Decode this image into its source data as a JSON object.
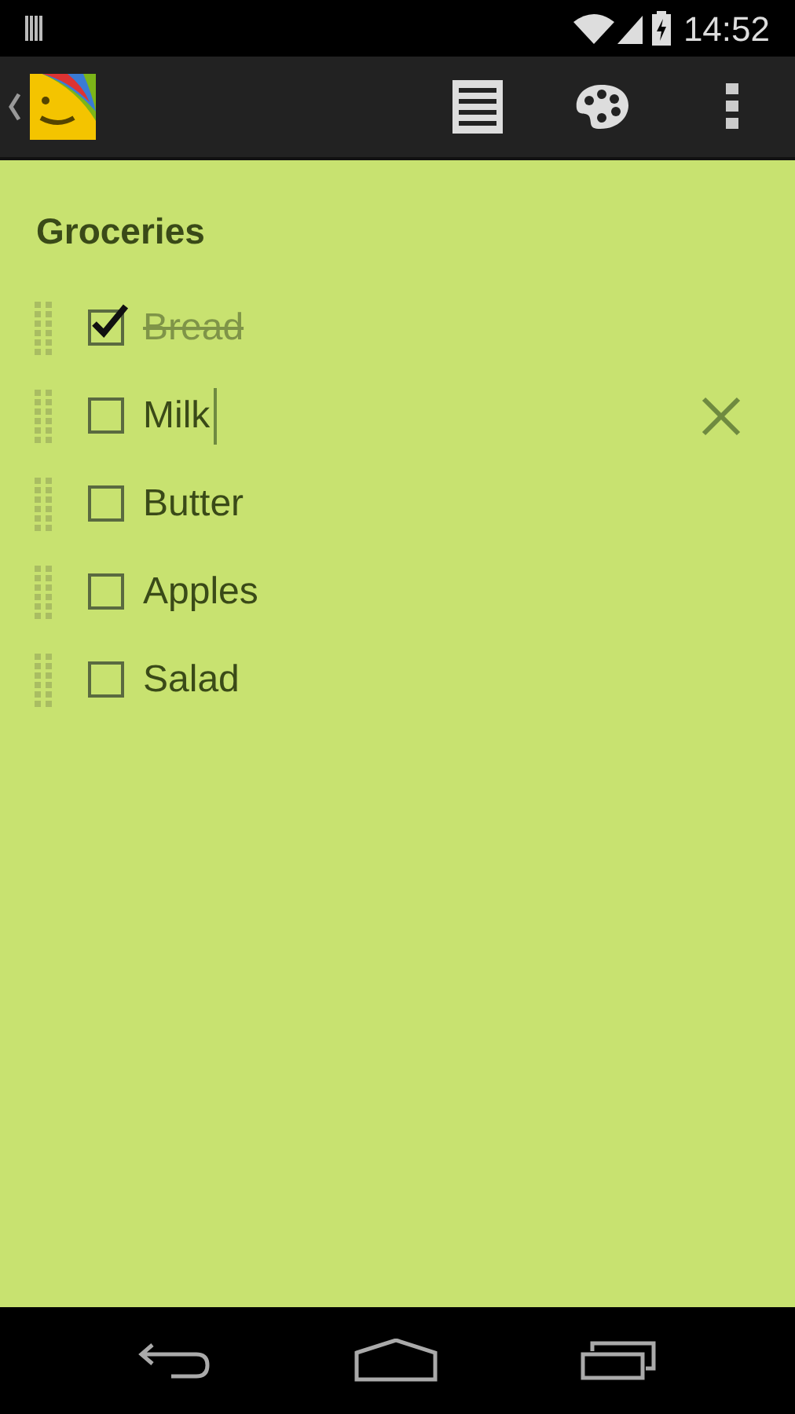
{
  "status_bar": {
    "time": "14:52"
  },
  "title": "Groceries",
  "items": [
    {
      "text": "Bread",
      "checked": true,
      "focused": false
    },
    {
      "text": "Milk",
      "checked": false,
      "focused": true
    },
    {
      "text": "Butter",
      "checked": false,
      "focused": false
    },
    {
      "text": "Apples",
      "checked": false,
      "focused": false
    },
    {
      "text": "Salad",
      "checked": false,
      "focused": false
    }
  ]
}
